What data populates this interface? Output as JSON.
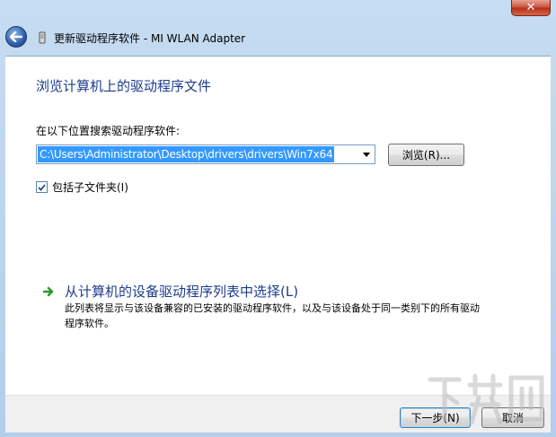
{
  "window": {
    "title": "更新驱动程序软件 - MI WLAN Adapter",
    "close_label": "✕"
  },
  "content": {
    "heading": "浏览计算机上的驱动程序文件",
    "search_label": "在以下位置搜索驱动程序软件:",
    "path_value": "C:\\Users\\Administrator\\Desktop\\drivers\\drivers\\Win7x64",
    "browse_label": "浏览(R)...",
    "include_subfolders": {
      "label": "包括子文件夹(I)",
      "checked": true
    },
    "pick_from_list": {
      "label": "从计算机的设备驱动程序列表中选择(L)",
      "description": "此列表将显示与该设备兼容的已安装的驱动程序软件，以及与该设备处于同一类别下的所有驱动程序软件。"
    }
  },
  "footer": {
    "next_label": "下一步(N)",
    "cancel_label": "取消"
  },
  "colors": {
    "heading": "#1e3c8c",
    "selection": "#3399ff",
    "arrow": "#2a9a2a"
  }
}
